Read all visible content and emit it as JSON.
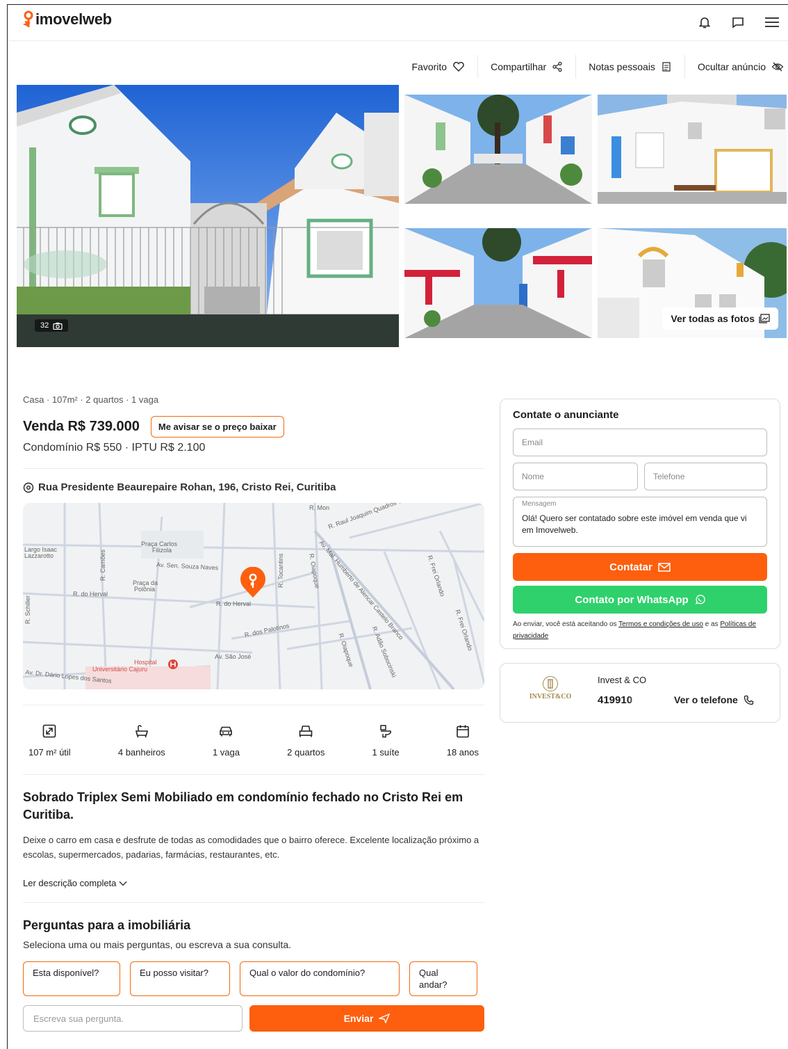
{
  "header": {
    "brand": "imovelweb",
    "icons": [
      "bell-icon",
      "chat-icon",
      "menu-icon"
    ]
  },
  "actions": {
    "favorite": "Favorito",
    "share": "Compartilhar",
    "notes": "Notas pessoais",
    "hide": "Ocultar anúncio"
  },
  "gallery": {
    "photo_count": "32",
    "see_all": "Ver todas as fotos"
  },
  "listing": {
    "summary": "Casa · 107m² · 2 quartos · 1 vaga",
    "price": "Venda R$ 739.000",
    "price_alert": "Me avisar se o preço baixar",
    "fees": "Condomínio R$ 550 · IPTU R$ 2.100",
    "address": "Rua Presidente Beaurepaire Rohan, 196, Cristo Rei, Curitiba"
  },
  "map": {
    "labels": {
      "r_mon": "R. Mon",
      "quadros": "R. Raul Joaquim Quadros Gomes",
      "largo": "Largo Isaac",
      "lazzarotto": "Lazzarotto",
      "praca_carlos": "Praça Carlos",
      "filizola": "Filizola",
      "camoes": "R. Camões",
      "souza_naves": "Av. Sen. Souza Naves",
      "praca_polonia": "Praça da",
      "polonia": "Polônia",
      "herval_left": "R. do Herval",
      "herval": "R. do Herval",
      "schiller": "R. Schiller",
      "tocantins": "R. Tocantins",
      "oiapoque": "R. Oiapoque",
      "mal_humberto": "Av. Mal. Humberto de Alencar Castelo Branco",
      "frei_orlando_top": "R. Frei Orlando",
      "frei_orlando_bottom": "R. Frei Orlando",
      "palotinos": "R. dos Palotinos",
      "oiapoque_bottom": "R. Oiapoque",
      "adao": "R. Adão Sobocinski",
      "sao_jose": "Av. São José",
      "hospital": "Hospital",
      "cajuru": "Universitário Cajuru",
      "dario": "Av. Dr. Dário Lopes dos Santos"
    }
  },
  "features": [
    {
      "icon": "area-icon",
      "label": "107 m² útil"
    },
    {
      "icon": "bathtub-icon",
      "label": "4 banheiros"
    },
    {
      "icon": "car-icon",
      "label": "1 vaga"
    },
    {
      "icon": "bed-icon",
      "label": "2 quartos"
    },
    {
      "icon": "toilet-icon",
      "label": "1 suíte"
    },
    {
      "icon": "calendar-icon",
      "label": "18 anos"
    }
  ],
  "description": {
    "title": "Sobrado Triplex Semi Mobiliado em condomínio fechado no Cristo Rei em Curitiba.",
    "text": "Deixe o carro em casa e desfrute de todas as comodidades que o bairro oferece. Excelente localização próximo a escolas, supermercados, padarias, farmácias, restaurantes, etc.",
    "read_more": "Ler descrição completa"
  },
  "questions": {
    "title": "Perguntas para a imobiliária",
    "subtitle": "Seleciona uma ou mais perguntas, ou escreva a sua consulta.",
    "chips": [
      "Esta disponível?",
      "Eu posso visitar?",
      "Qual o valor do condomínio?",
      "Qual andar?"
    ],
    "input_placeholder": "Escreva sua pergunta.",
    "send": "Enviar"
  },
  "contact": {
    "title": "Contate o anunciante",
    "email": "Email",
    "name": "Nome",
    "phone": "Telefone",
    "message_label": "Mensagem",
    "message_value": "Olá! Quero ser contatado sobre este imóvel em venda que vi em Imovelweb.",
    "submit": "Contatar",
    "whatsapp": "Contato por WhatsApp",
    "legal_prefix": "Ao enviar, você está aceitando os ",
    "terms": "Termos e condições de uso",
    "legal_and": " e as ",
    "privacy": "Políticas de privacidade"
  },
  "agency": {
    "logo_text": "INVEST&CO",
    "name": "Invest & CO",
    "phone": "419910",
    "view_phone": "Ver o telefone"
  },
  "colors": {
    "accent": "#fd5f0f",
    "whatsapp": "#2fd16c"
  }
}
